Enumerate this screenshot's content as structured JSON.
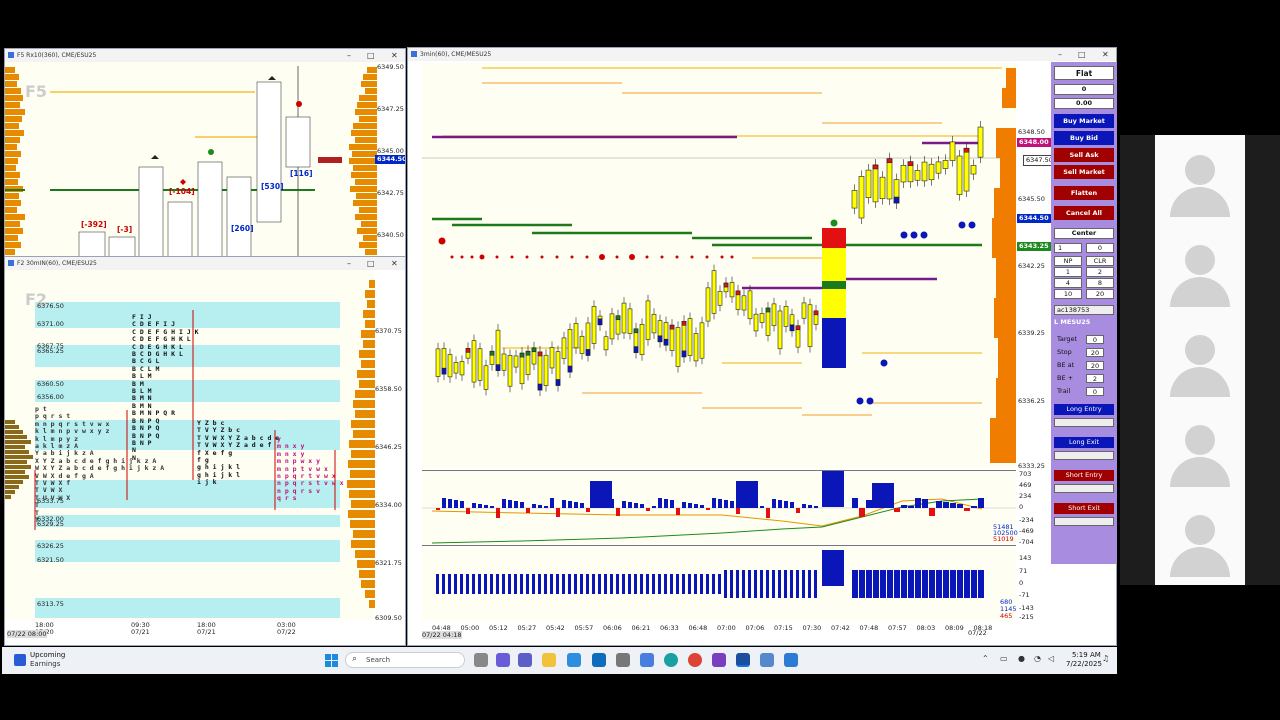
{
  "window_f5": {
    "title": "F5 Rx10(360), CME/ESU25",
    "watermark": "F5",
    "price_labels": [
      "6349.50",
      "6347.25",
      "6345.00",
      "6342.75",
      "6340.50"
    ],
    "current_price": "6344.50",
    "annotations": [
      "[-392]",
      "[-3]",
      "[-104]",
      "[260]",
      "[530]",
      "[116]"
    ]
  },
  "window_f2": {
    "title": "F2 30mIN(60), CME/ESU25",
    "watermark": "F2",
    "left_prices": [
      "6376.50",
      "6371.00",
      "6367.75",
      "6365.25",
      "6360.50",
      "6356.00",
      "6333.75",
      "6332.00",
      "6329.25",
      "6326.25",
      "6321.50",
      "6313.75"
    ],
    "right_prices": [
      "6370.75",
      "6358.50",
      "6346.25",
      "6334.00",
      "6321.75",
      "6309.50"
    ],
    "time_labels": [
      "18:00",
      "09:30",
      "18:00",
      "03:00"
    ],
    "date_labels": [
      "07/20",
      "07/21",
      "07/21",
      "07/22"
    ],
    "start_date": "07/22 08:00",
    "tpo_col1": "F I J\nC D E F I J\nC D E F G H I J K\nC D E F G H K L\nC D E G H K L\nB C D G H K L\nB C G L\nB C L M\nB L M\nB M\nB L M\nB M N\nB M N\nB M N P Q R\nB N P Q\nB N P Q\nB N P Q\nB N P\nN\nN",
    "tpo_col0": "p t\np q r s t\nm n p q r s t v w x\nk l m n p v w x y z\nk l m p y z\na k l m z A\nY a b i j k z A\nX Y Z a b c d e f g h i j k z A\nW X Y Z a b c d e f g h i j k z A\nV W X d e f g A\nT V W X f\nT V W X\nT U V W X\nT\nT\nT",
    "tpo_col2": "Y Z b c\nT V Y Z b c\nT V W X Y Z a b c d e\nT V W X Y Z a d e f\nf X e f g\nf g\ng h i j k l\ng h i j k l\ni j k",
    "tpo_col3": "y\nm n x y\nm n x y\nm n p w x y\nm n p t v w x\nn p q r t v w x\nn p q r s t v w x\nn p q r s v\nq r s"
  },
  "window_main": {
    "title": "3min(60), CME/MESU25",
    "price_labels": [
      "6348.50",
      "6348.00",
      "6347.50",
      "6345.50",
      "6344.50",
      "6343.25",
      "6342.25",
      "6339.25",
      "6336.25",
      "6333.25"
    ],
    "time_labels": [
      "04:48",
      "05:00",
      "05:12",
      "05:27",
      "05:42",
      "05:57",
      "06:06",
      "06:21",
      "06:33",
      "06:48",
      "07:00",
      "07:06",
      "07:15",
      "07:30",
      "07:42",
      "07:48",
      "07:57",
      "08:03",
      "08:09",
      "08:18"
    ],
    "date_label": "07/22",
    "start_date": "07/22 04:18",
    "delta_labels": [
      "703",
      "469",
      "234",
      "0",
      "-234",
      "-469",
      "-704"
    ],
    "delta_values": [
      "51481",
      "102500",
      "51019"
    ],
    "vol_labels": [
      "143",
      "71",
      "0",
      "-71",
      "-143",
      "-215"
    ],
    "vol_values": [
      "680",
      "1145",
      "465"
    ]
  },
  "panel": {
    "position": "Flat",
    "qty": "0",
    "pnl": "0.00",
    "buttons": [
      "Buy Market",
      "Buy Bid",
      "Sell Ask",
      "Sell Market",
      "Flatten",
      "Cancel All"
    ],
    "center": "Center",
    "qty_input": "1",
    "qty_right": "0",
    "grid": [
      "NP",
      "CLR",
      "1",
      "2",
      "4",
      "8",
      "10",
      "20"
    ],
    "account": "ac138753",
    "instrument": "L MESU25",
    "fields": [
      {
        "label": "Target",
        "value": "0"
      },
      {
        "label": "Stop",
        "value": "20"
      },
      {
        "label": "BE at",
        "value": "20"
      },
      {
        "label": "BE +",
        "value": "2"
      },
      {
        "label": "Trail",
        "value": "0"
      }
    ],
    "entry_buttons": [
      "Long Entry",
      "Long Exit",
      "Short Entry",
      "Short Exit"
    ]
  },
  "taskbar": {
    "weather_title": "Upcoming",
    "weather_sub": "Earnings",
    "search": "Search",
    "time": "5:19 AM",
    "date": "7/22/2025"
  },
  "colors": {
    "buy": "#0a16b8",
    "sell": "#a00000",
    "panel": "#a78ce0",
    "band": "#b7eef0",
    "price_blue": "#0028c8"
  }
}
